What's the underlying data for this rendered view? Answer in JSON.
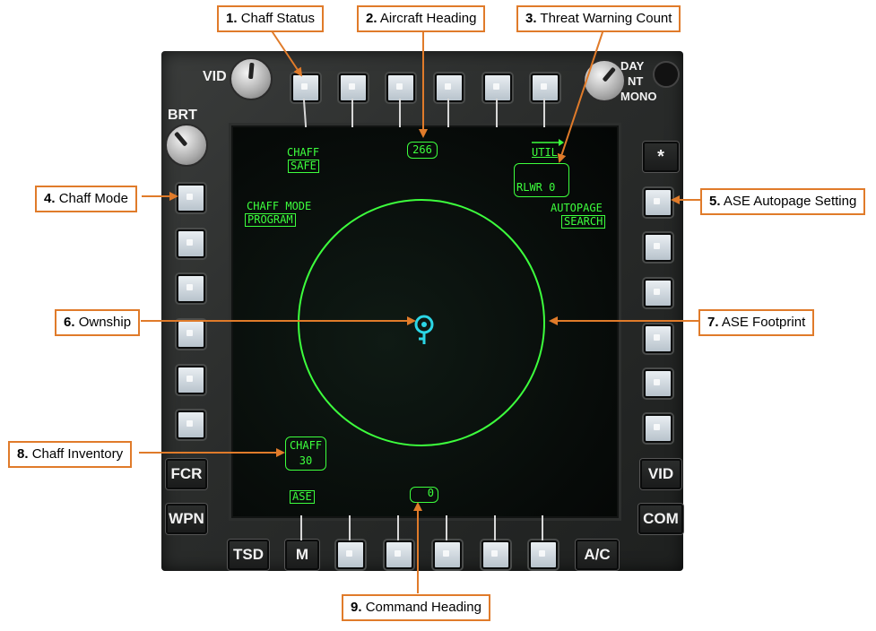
{
  "colors": {
    "symbology": "#3dff3d",
    "ownship": "#2bd6e6",
    "callout_border": "#e07b2a",
    "bezel": "#2a2c2b"
  },
  "bezel": {
    "knob_vid_label": "VID",
    "knob_brt_label": "BRT",
    "knob_day_label": "DAY",
    "knob_nt_label": "NT",
    "knob_mono_label": "MONO",
    "star_button": "*",
    "left_fcr": "FCR",
    "left_wpn": "WPN",
    "right_vid": "VID",
    "right_com": "COM",
    "bottom_tsd": "TSD",
    "bottom_m": "M",
    "bottom_ac": "A/C"
  },
  "display": {
    "chaff_label": "CHAFF",
    "chaff_status": "SAFE",
    "heading": "266",
    "util_label": "UTIL",
    "rlwr_count": "RLWR 0",
    "chaff_mode_label": "CHAFF MODE",
    "chaff_mode_value": "PROGRAM",
    "autopage_label": "AUTOPAGE",
    "autopage_value": "SEARCH",
    "chaff_inventory_label": "CHAFF",
    "chaff_inventory_value": "30",
    "ase_label": "ASE",
    "command_heading": "0",
    "ownship_icon": "ownship-symbol"
  },
  "callouts": [
    {
      "num": "1.",
      "text": "Chaff Status"
    },
    {
      "num": "2.",
      "text": "Aircraft Heading"
    },
    {
      "num": "3.",
      "text": "Threat Warning Count"
    },
    {
      "num": "4.",
      "text": "Chaff Mode"
    },
    {
      "num": "5.",
      "text": "ASE Autopage Setting"
    },
    {
      "num": "6.",
      "text": "Ownship"
    },
    {
      "num": "7.",
      "text": "ASE Footprint"
    },
    {
      "num": "8.",
      "text": "Chaff Inventory"
    },
    {
      "num": "9.",
      "text": "Command Heading"
    }
  ]
}
